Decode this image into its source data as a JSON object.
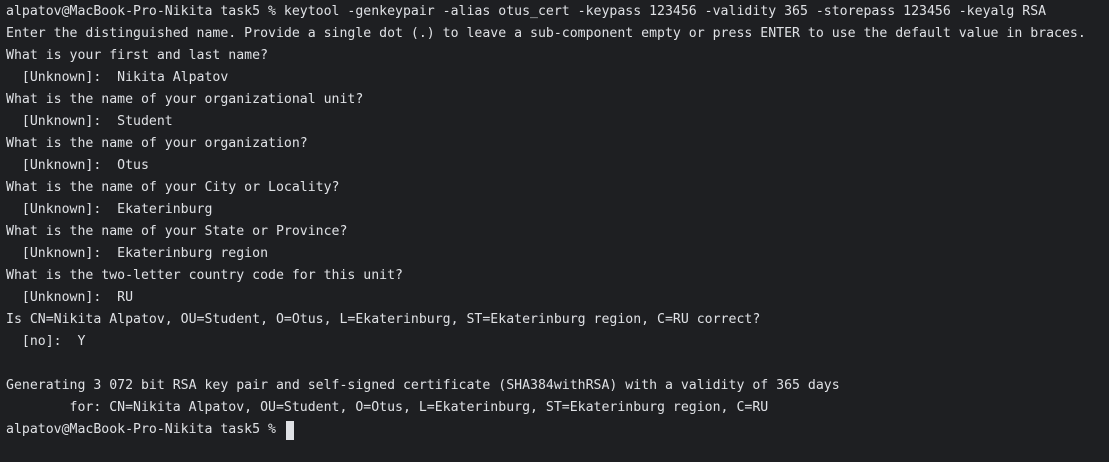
{
  "terminal": {
    "lines": [
      "alpatov@MacBook-Pro-Nikita task5 % keytool -genkeypair -alias otus_cert -keypass 123456 -validity 365 -storepass 123456 -keyalg RSA",
      "Enter the distinguished name. Provide a single dot (.) to leave a sub-component empty or press ENTER to use the default value in braces.",
      "What is your first and last name?",
      "  [Unknown]:  Nikita Alpatov",
      "What is the name of your organizational unit?",
      "  [Unknown]:  Student",
      "What is the name of your organization?",
      "  [Unknown]:  Otus",
      "What is the name of your City or Locality?",
      "  [Unknown]:  Ekaterinburg",
      "What is the name of your State or Province?",
      "  [Unknown]:  Ekaterinburg region",
      "What is the two-letter country code for this unit?",
      "  [Unknown]:  RU",
      "Is CN=Nikita Alpatov, OU=Student, O=Otus, L=Ekaterinburg, ST=Ekaterinburg region, C=RU correct?",
      "  [no]:  Y",
      "",
      "Generating 3 072 bit RSA key pair and self-signed certificate (SHA384withRSA) with a validity of 365 days",
      "        for: CN=Nikita Alpatov, OU=Student, O=Otus, L=Ekaterinburg, ST=Ekaterinburg region, C=RU"
    ],
    "prompt": "alpatov@MacBook-Pro-Nikita task5 % ",
    "colors": {
      "background": "#1e1f22",
      "foreground": "#dfe1e5"
    }
  }
}
